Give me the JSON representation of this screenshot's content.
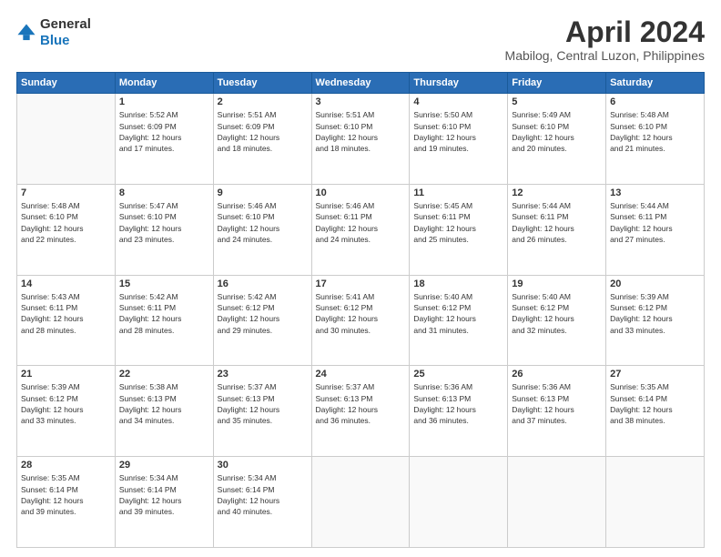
{
  "header": {
    "logo": {
      "text1": "General",
      "text2": "Blue"
    },
    "title": "April 2024",
    "subtitle": "Mabilog, Central Luzon, Philippines"
  },
  "days_of_week": [
    "Sunday",
    "Monday",
    "Tuesday",
    "Wednesday",
    "Thursday",
    "Friday",
    "Saturday"
  ],
  "weeks": [
    [
      {
        "day": "",
        "info": ""
      },
      {
        "day": "1",
        "info": "Sunrise: 5:52 AM\nSunset: 6:09 PM\nDaylight: 12 hours\nand 17 minutes."
      },
      {
        "day": "2",
        "info": "Sunrise: 5:51 AM\nSunset: 6:09 PM\nDaylight: 12 hours\nand 18 minutes."
      },
      {
        "day": "3",
        "info": "Sunrise: 5:51 AM\nSunset: 6:10 PM\nDaylight: 12 hours\nand 18 minutes."
      },
      {
        "day": "4",
        "info": "Sunrise: 5:50 AM\nSunset: 6:10 PM\nDaylight: 12 hours\nand 19 minutes."
      },
      {
        "day": "5",
        "info": "Sunrise: 5:49 AM\nSunset: 6:10 PM\nDaylight: 12 hours\nand 20 minutes."
      },
      {
        "day": "6",
        "info": "Sunrise: 5:48 AM\nSunset: 6:10 PM\nDaylight: 12 hours\nand 21 minutes."
      }
    ],
    [
      {
        "day": "7",
        "info": "Sunrise: 5:48 AM\nSunset: 6:10 PM\nDaylight: 12 hours\nand 22 minutes."
      },
      {
        "day": "8",
        "info": "Sunrise: 5:47 AM\nSunset: 6:10 PM\nDaylight: 12 hours\nand 23 minutes."
      },
      {
        "day": "9",
        "info": "Sunrise: 5:46 AM\nSunset: 6:10 PM\nDaylight: 12 hours\nand 24 minutes."
      },
      {
        "day": "10",
        "info": "Sunrise: 5:46 AM\nSunset: 6:11 PM\nDaylight: 12 hours\nand 24 minutes."
      },
      {
        "day": "11",
        "info": "Sunrise: 5:45 AM\nSunset: 6:11 PM\nDaylight: 12 hours\nand 25 minutes."
      },
      {
        "day": "12",
        "info": "Sunrise: 5:44 AM\nSunset: 6:11 PM\nDaylight: 12 hours\nand 26 minutes."
      },
      {
        "day": "13",
        "info": "Sunrise: 5:44 AM\nSunset: 6:11 PM\nDaylight: 12 hours\nand 27 minutes."
      }
    ],
    [
      {
        "day": "14",
        "info": "Sunrise: 5:43 AM\nSunset: 6:11 PM\nDaylight: 12 hours\nand 28 minutes."
      },
      {
        "day": "15",
        "info": "Sunrise: 5:42 AM\nSunset: 6:11 PM\nDaylight: 12 hours\nand 28 minutes."
      },
      {
        "day": "16",
        "info": "Sunrise: 5:42 AM\nSunset: 6:12 PM\nDaylight: 12 hours\nand 29 minutes."
      },
      {
        "day": "17",
        "info": "Sunrise: 5:41 AM\nSunset: 6:12 PM\nDaylight: 12 hours\nand 30 minutes."
      },
      {
        "day": "18",
        "info": "Sunrise: 5:40 AM\nSunset: 6:12 PM\nDaylight: 12 hours\nand 31 minutes."
      },
      {
        "day": "19",
        "info": "Sunrise: 5:40 AM\nSunset: 6:12 PM\nDaylight: 12 hours\nand 32 minutes."
      },
      {
        "day": "20",
        "info": "Sunrise: 5:39 AM\nSunset: 6:12 PM\nDaylight: 12 hours\nand 33 minutes."
      }
    ],
    [
      {
        "day": "21",
        "info": "Sunrise: 5:39 AM\nSunset: 6:12 PM\nDaylight: 12 hours\nand 33 minutes."
      },
      {
        "day": "22",
        "info": "Sunrise: 5:38 AM\nSunset: 6:13 PM\nDaylight: 12 hours\nand 34 minutes."
      },
      {
        "day": "23",
        "info": "Sunrise: 5:37 AM\nSunset: 6:13 PM\nDaylight: 12 hours\nand 35 minutes."
      },
      {
        "day": "24",
        "info": "Sunrise: 5:37 AM\nSunset: 6:13 PM\nDaylight: 12 hours\nand 36 minutes."
      },
      {
        "day": "25",
        "info": "Sunrise: 5:36 AM\nSunset: 6:13 PM\nDaylight: 12 hours\nand 36 minutes."
      },
      {
        "day": "26",
        "info": "Sunrise: 5:36 AM\nSunset: 6:13 PM\nDaylight: 12 hours\nand 37 minutes."
      },
      {
        "day": "27",
        "info": "Sunrise: 5:35 AM\nSunset: 6:14 PM\nDaylight: 12 hours\nand 38 minutes."
      }
    ],
    [
      {
        "day": "28",
        "info": "Sunrise: 5:35 AM\nSunset: 6:14 PM\nDaylight: 12 hours\nand 39 minutes."
      },
      {
        "day": "29",
        "info": "Sunrise: 5:34 AM\nSunset: 6:14 PM\nDaylight: 12 hours\nand 39 minutes."
      },
      {
        "day": "30",
        "info": "Sunrise: 5:34 AM\nSunset: 6:14 PM\nDaylight: 12 hours\nand 40 minutes."
      },
      {
        "day": "",
        "info": ""
      },
      {
        "day": "",
        "info": ""
      },
      {
        "day": "",
        "info": ""
      },
      {
        "day": "",
        "info": ""
      }
    ]
  ]
}
